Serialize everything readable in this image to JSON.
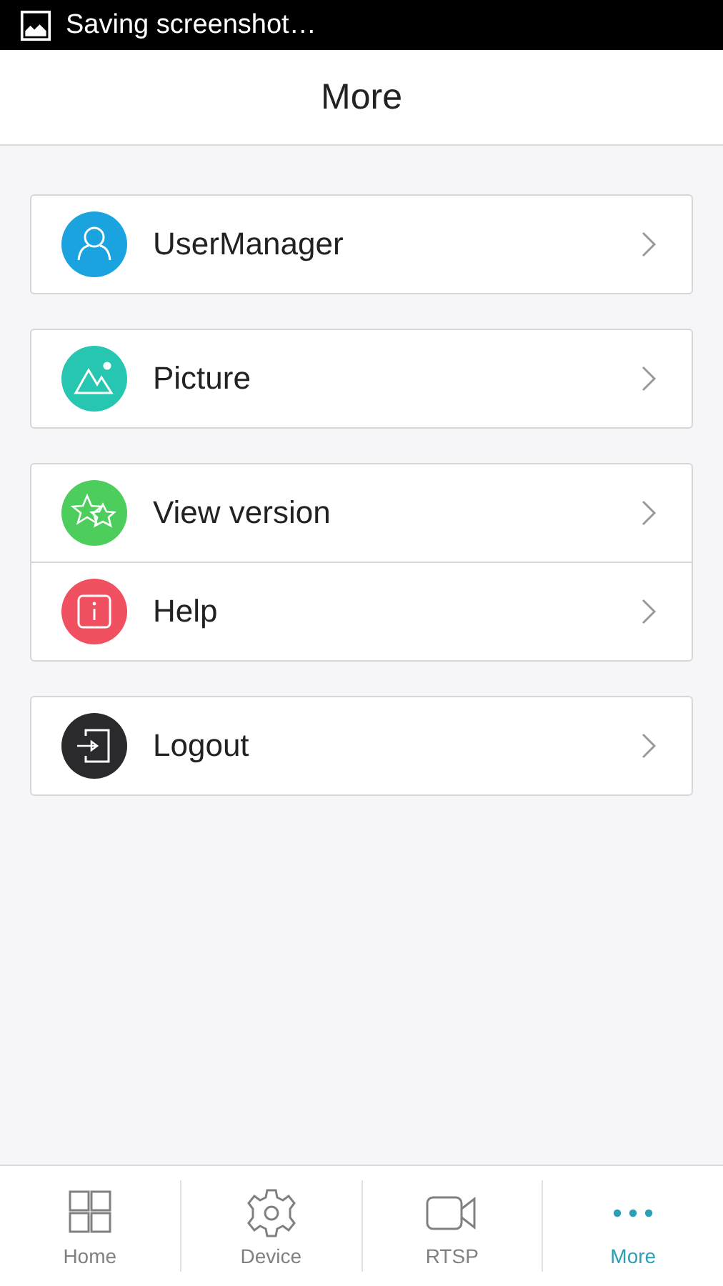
{
  "status_bar": {
    "notification": "Saving screenshot…"
  },
  "header": {
    "title": "More"
  },
  "groups": [
    {
      "items": [
        {
          "label": "UserManager",
          "kind": "user",
          "color": "#1aa3de"
        }
      ]
    },
    {
      "items": [
        {
          "label": "Picture",
          "kind": "picture",
          "color": "#26c6b0"
        }
      ]
    },
    {
      "items": [
        {
          "label": "View version",
          "kind": "star",
          "color": "#4ccd5c"
        },
        {
          "label": "Help",
          "kind": "info",
          "color": "#f0505f"
        }
      ]
    },
    {
      "items": [
        {
          "label": "Logout",
          "kind": "logout",
          "color": "#2a2a2c"
        }
      ]
    }
  ],
  "tabs": [
    {
      "label": "Home",
      "kind": "grid",
      "selected": false
    },
    {
      "label": "Device",
      "kind": "gear",
      "selected": false
    },
    {
      "label": "RTSP",
      "kind": "camera",
      "selected": false
    },
    {
      "label": "More",
      "kind": "dots",
      "selected": true
    }
  ]
}
